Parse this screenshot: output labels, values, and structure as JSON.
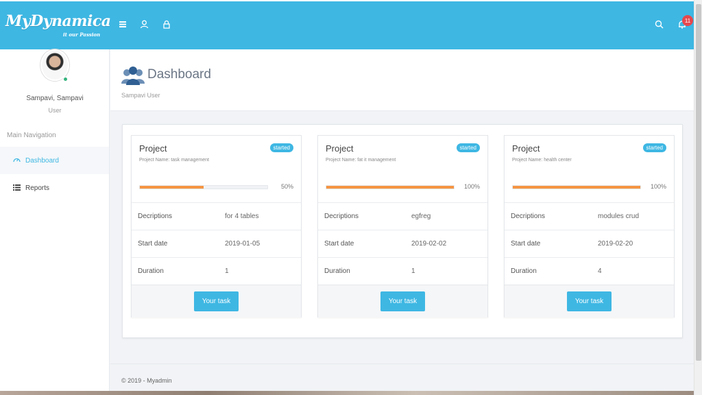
{
  "header": {
    "logo_text": "MyDynamica",
    "logo_tagline": "it our Passion",
    "notification_count": "11",
    "icons": [
      "menu-icon",
      "user-icon",
      "lock-icon",
      "search-icon",
      "bell-icon"
    ]
  },
  "sidebar": {
    "user_name": "Sampavi, Sampavi",
    "user_role": "User",
    "nav_heading": "Main Navigation",
    "items": [
      {
        "label": "Dashboard",
        "icon": "dashboard-icon",
        "active": true
      },
      {
        "label": "Reports",
        "icon": "list-icon",
        "active": false
      }
    ]
  },
  "page": {
    "title": "Dashboard",
    "subtitle": "Sampavi User"
  },
  "cards": [
    {
      "title": "Project",
      "status": "started",
      "project_name": "Project Name: task management",
      "progress": 50,
      "progress_label": "50%",
      "rows": [
        {
          "label": "Decriptions",
          "value": "for 4 tables"
        },
        {
          "label": "Start date",
          "value": "2019-01-05"
        },
        {
          "label": "Duration",
          "value": "1"
        }
      ],
      "button": "Your task"
    },
    {
      "title": "Project",
      "status": "started",
      "project_name": "Project Name: fat it management",
      "progress": 100,
      "progress_label": "100%",
      "rows": [
        {
          "label": "Decriptions",
          "value": "egfreg"
        },
        {
          "label": "Start date",
          "value": "2019-02-02"
        },
        {
          "label": "Duration",
          "value": "1"
        }
      ],
      "button": "Your task"
    },
    {
      "title": "Project",
      "status": "started",
      "project_name": "Project Name: health center",
      "progress": 100,
      "progress_label": "100%",
      "rows": [
        {
          "label": "Decriptions",
          "value": "modules crud"
        },
        {
          "label": "Start date",
          "value": "2019-02-20"
        },
        {
          "label": "Duration",
          "value": "4"
        }
      ],
      "button": "Your task"
    }
  ],
  "footer": {
    "text": "© 2019 - Myadmin"
  },
  "colors": {
    "accent": "#3eb7e3",
    "progress": "#f59542",
    "badge": "#e5484d"
  }
}
